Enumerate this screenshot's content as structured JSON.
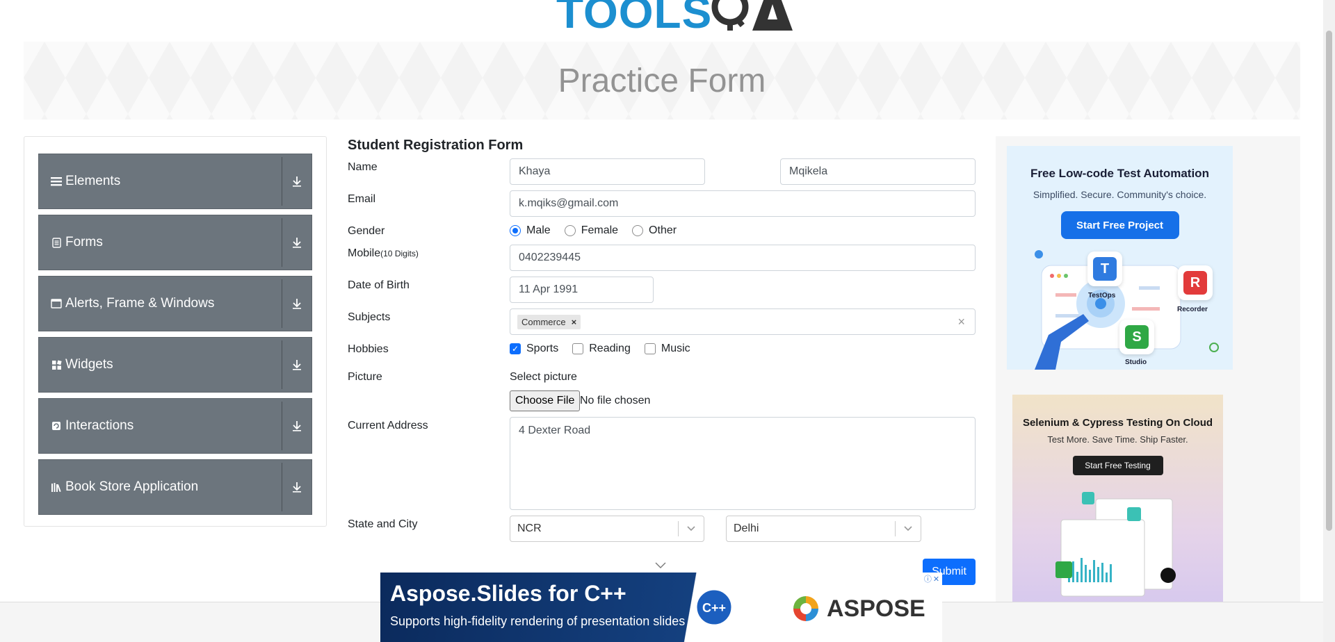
{
  "logo": {
    "text": "TOOLS",
    "icon": "qa-gear-icon"
  },
  "banner": {
    "title": "Practice Form"
  },
  "sidebar": {
    "groups": [
      {
        "label": "Elements",
        "icon": "hamburger-icon"
      },
      {
        "label": "Forms",
        "icon": "document-icon"
      },
      {
        "label": "Alerts, Frame & Windows",
        "icon": "window-icon"
      },
      {
        "label": "Widgets",
        "icon": "widgets-icon"
      },
      {
        "label": "Interactions",
        "icon": "interactions-icon"
      },
      {
        "label": "Book Store Application",
        "icon": "books-icon"
      }
    ]
  },
  "form": {
    "heading": "Student Registration Form",
    "name_label": "Name",
    "first_name": "Khaya",
    "last_name": "Mqikela",
    "email_label": "Email",
    "email": "k.mqiks@gmail.com",
    "gender_label": "Gender",
    "gender_options": [
      "Male",
      "Female",
      "Other"
    ],
    "mobile_label": "Mobile",
    "mobile_hint": "(10 Digits)",
    "mobile": "0402239445",
    "dob_label": "Date of Birth",
    "dob": "11 Apr 1991",
    "subjects_label": "Subjects",
    "subject_tag": "Commerce",
    "subject_tag_remove": "×",
    "clear_symbol": "×",
    "hobbies_label": "Hobbies",
    "hobbies": [
      "Sports",
      "Reading",
      "Music"
    ],
    "picture_label": "Picture",
    "select_picture": "Select picture",
    "choose_file": "Choose File",
    "no_file": "No file chosen",
    "address_label": "Current Address",
    "address": "4 Dexter Road",
    "state_city_label": "State and City",
    "state": "NCR",
    "city": "Delhi",
    "submit": "Submit"
  },
  "ads": {
    "ad1": {
      "title": "Free Low-code Test Automation",
      "subtitle": "Simplified. Secure. Community's choice.",
      "button": "Start Free Project",
      "tiles": [
        "TestOps",
        "Recorder",
        "Studio"
      ]
    },
    "ad2": {
      "title": "Selenium & Cypress Testing On Cloud",
      "subtitle": "Test More. Save Time. Ship Faster.",
      "button": "Start Free Testing"
    },
    "bottom": {
      "title": "Aspose.Slides for C++",
      "subtitle": "Supports high-fidelity rendering of presentation slides",
      "brand": "ASPOSE"
    }
  },
  "colors": {
    "accent": "#0d6efd",
    "sidebar_group": "#6c757d",
    "logo_blue": "#1c8fd0"
  }
}
